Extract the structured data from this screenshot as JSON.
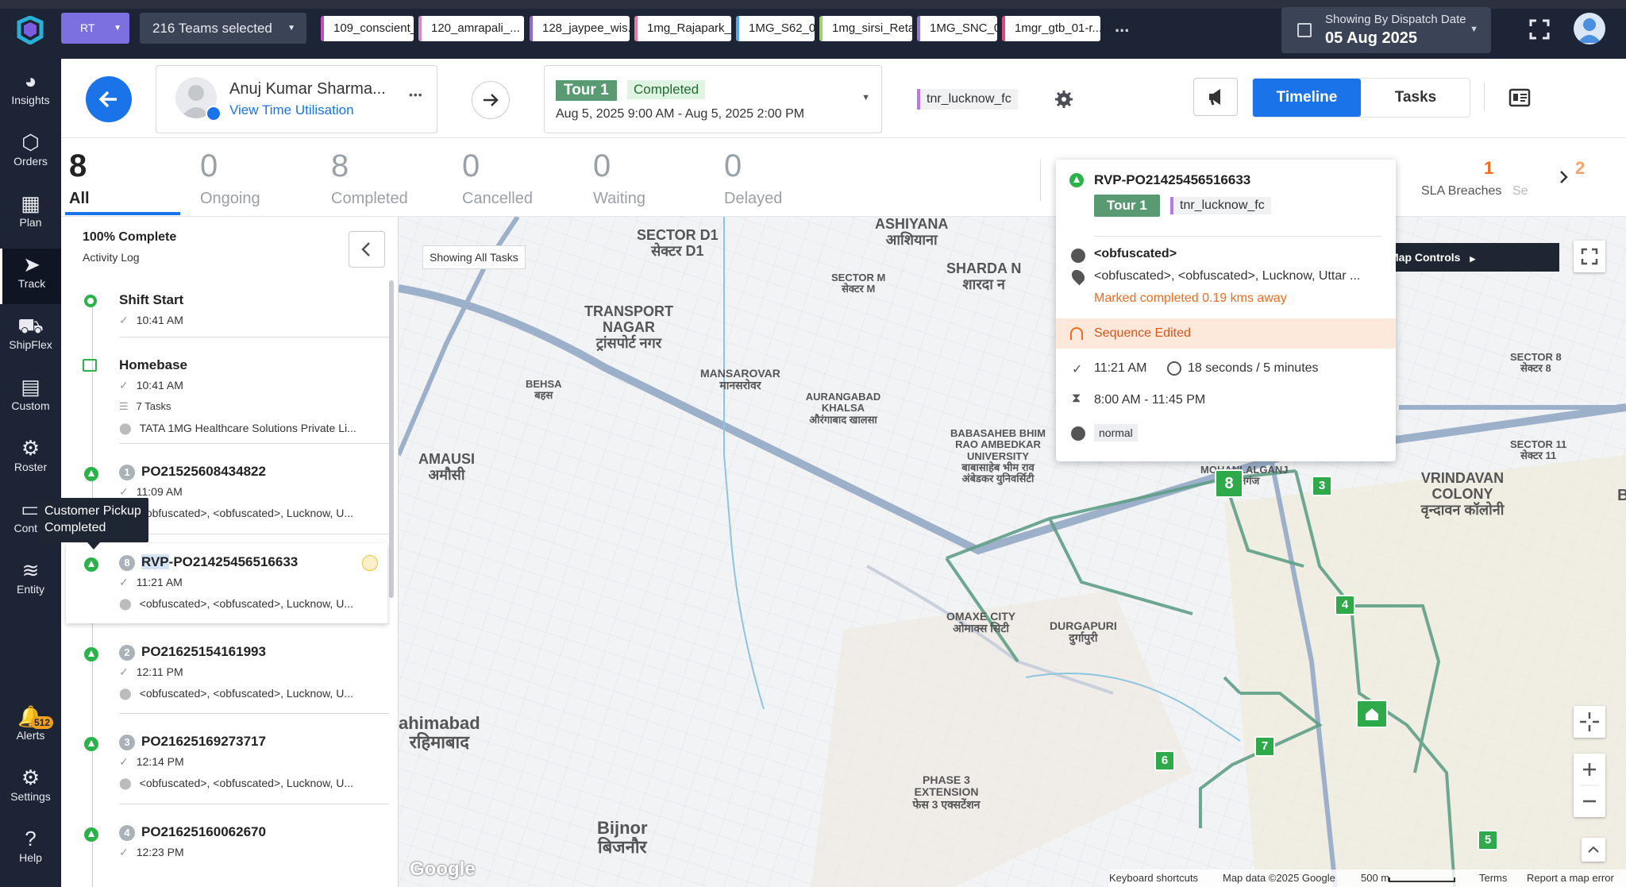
{
  "header": {
    "org_badge": "RT",
    "teams_label": "216 Teams selected",
    "team_chips": [
      {
        "label": "109_conscient_...",
        "color": "#c44fbf"
      },
      {
        "label": "120_amrapali_...",
        "color": "#d889c9"
      },
      {
        "label": "128_jaypee_wis...",
        "color": "#9966cc"
      },
      {
        "label": "1mg_Rajapark_...",
        "color": "#e87aa0"
      },
      {
        "label": "1MG_S62_01",
        "color": "#5aa8e6"
      },
      {
        "label": "1mg_sirsi_Retail",
        "color": "#9ed26b"
      },
      {
        "label": "1MG_SNC_01",
        "color": "#8a7ae0"
      },
      {
        "label": "1mgr_gtb_01-r...",
        "color": "#e04a7a"
      }
    ],
    "more_label": "...",
    "date_caption": "Showing By Dispatch Date",
    "date_value": "05 Aug 2025"
  },
  "sidebar": {
    "items": [
      {
        "label": "Insights",
        "icon": "insights-icon"
      },
      {
        "label": "Orders",
        "icon": "orders-icon"
      },
      {
        "label": "Plan",
        "icon": "plan-icon"
      },
      {
        "label": "Track",
        "icon": "track-icon"
      },
      {
        "label": "ShipFlex",
        "icon": "truck-icon"
      },
      {
        "label": "Custom",
        "icon": "clipboard-icon"
      },
      {
        "label": "Roster",
        "icon": "gear-icon"
      },
      {
        "label": "Contra",
        "icon": "document-icon"
      },
      {
        "label": "Entity",
        "icon": "database-icon"
      },
      {
        "label": "Alerts",
        "icon": "bell-icon",
        "badge": "512"
      },
      {
        "label": "Settings",
        "icon": "settings-icon"
      },
      {
        "label": "Help",
        "icon": "help-icon"
      }
    ],
    "tooltip": "Customer Pickup Completed"
  },
  "agent": {
    "name": "Anuj Kumar Sharma...",
    "link": "View Time Utilisation",
    "more": "•••"
  },
  "tour": {
    "name": "Tour 1",
    "status": "Completed",
    "window": "Aug 5, 2025 9:00 AM - Aug 5, 2025 2:00 PM",
    "hub_tag": "tnr_lucknow_fc"
  },
  "view_toggle": {
    "timeline": "Timeline",
    "tasks": "Tasks"
  },
  "stats": [
    {
      "value": "8",
      "label": "All"
    },
    {
      "value": "0",
      "label": "Ongoing"
    },
    {
      "value": "8",
      "label": "Completed"
    },
    {
      "value": "0",
      "label": "Cancelled"
    },
    {
      "value": "0",
      "label": "Waiting"
    },
    {
      "value": "0",
      "label": "Delayed"
    }
  ],
  "stats_right": [
    {
      "value": "1",
      "label": "SLA Breaches",
      "color": "#f26b1d"
    },
    {
      "value": "2",
      "label": "Se",
      "color": "#f4a36b"
    }
  ],
  "stats_partial": "e",
  "activity": {
    "progress": "100% Complete",
    "log_label": "Activity Log",
    "items": [
      {
        "title": "Shift Start",
        "time": "10:41 AM"
      },
      {
        "title": "Homebase",
        "time": "10:41 AM",
        "tasks": "7 Tasks",
        "address": "TATA 1MG Healthcare Solutions Private Li..."
      },
      {
        "seq": "1",
        "title": "PO21525608434822",
        "time": "11:09 AM",
        "address": "<obfuscated>, <obfuscated>, Lucknow, U..."
      },
      {
        "seq": "8",
        "title_prefix": "RVP",
        "title": "-PO21425456516633",
        "time": "11:21 AM",
        "address": "<obfuscated>, <obfuscated>, Lucknow, U..."
      },
      {
        "seq": "2",
        "title": "PO21625154161993",
        "time": "12:11 PM",
        "address": "<obfuscated>, <obfuscated>, Lucknow, U..."
      },
      {
        "seq": "3",
        "title": "PO21625169273717",
        "time": "12:14 PM",
        "address": "<obfuscated>, <obfuscated>, Lucknow, U..."
      },
      {
        "seq": "4",
        "title": "PO21625160062670",
        "time": "12:23 PM"
      }
    ]
  },
  "map": {
    "showing_all": "Showing All Tasks",
    "controls_label": "Map Controls",
    "labels": [
      {
        "en": "SECTOR D1",
        "hi": "सेक्टर D1"
      },
      {
        "en": "ASHIYANA",
        "hi": "आशियाना"
      },
      {
        "en": "SECTOR M",
        "hi": "सेक्टर M"
      },
      {
        "en": "SHARDA N",
        "hi": "शारदा न"
      },
      {
        "en": "TRANSPORT NAGAR",
        "hi": "ट्रांसपोर्ट नगर"
      },
      {
        "en": "MANSAROVAR",
        "hi": "मानसरोवर"
      },
      {
        "en": "BEHSA",
        "hi": "बहस"
      },
      {
        "en": "AURANGABAD KHALSA",
        "hi": "औरंगाबाद खालसा"
      },
      {
        "en": "BABASAHEB BHIM RAO AMBEDKAR UNIVERSITY",
        "hi": "बाबासाहेब भीम राव अंबेडकर युनिवर्सिटी"
      },
      {
        "en": "AMAUSI",
        "hi": "अमौसी"
      },
      {
        "en": "OMAXE CITY",
        "hi": "ओमाक्स सिटी"
      },
      {
        "en": "DURGAPURI",
        "hi": "दुर्गापुरी"
      },
      {
        "en": "VRINDAVAN COLONY",
        "hi": "वृन्दावन कॉलोनी"
      },
      {
        "en": "SECTOR 11",
        "hi": "सेक्टर 11"
      },
      {
        "en": "SECTOR 8",
        "hi": "सेक्टर 8"
      },
      {
        "en": "ahimabad",
        "hi": "रहिमाबाद"
      },
      {
        "en": "PHASE 3 EXTENSION",
        "hi": "फेस 3 एक्सटेंशन"
      },
      {
        "en": "Bijnor",
        "hi": "बिजनौर"
      },
      {
        "en": "MOHANLALGANJ",
        "hi": "लालगंज"
      },
      {
        "en": "B",
        "hi": ""
      }
    ],
    "markers": [
      "8",
      "3",
      "4",
      "7",
      "6",
      "5"
    ],
    "footer": {
      "google": "Google",
      "shortcuts": "Keyboard shortcuts",
      "mapdata": "Map data ©2025 Google",
      "scale": "500 m",
      "terms": "Terms",
      "report": "Report a map error"
    }
  },
  "popup": {
    "task_id": "RVP-PO21425456516633",
    "tour": "Tour 1",
    "hub": "tnr_lucknow_fc",
    "customer": "<obfuscated>",
    "address": "<obfuscated>, <obfuscated>, Lucknow, Uttar ...",
    "distance_note": "Marked completed 0.19 kms away",
    "sequence_note": "Sequence Edited",
    "completed_time": "11:21 AM",
    "duration": "18 seconds / 5 minutes",
    "window": "8:00 AM - 11:45 PM",
    "priority": "normal"
  }
}
